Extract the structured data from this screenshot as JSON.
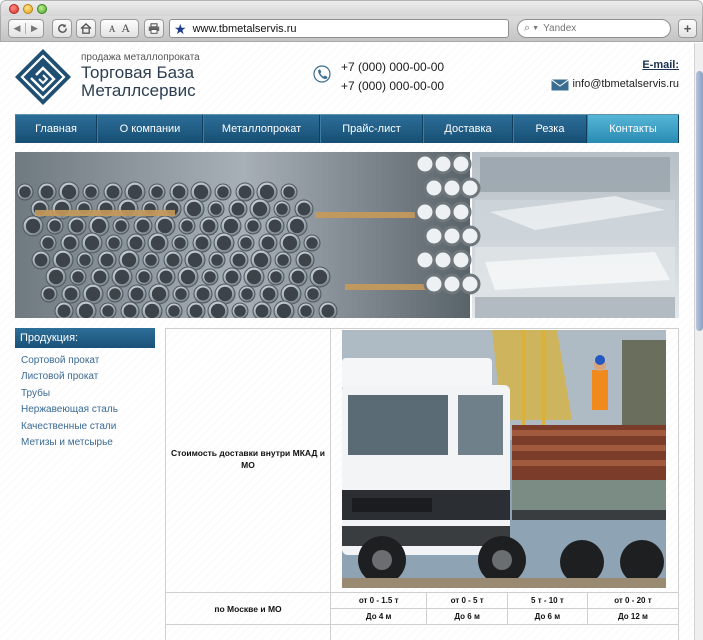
{
  "browser": {
    "nav_back": "◀",
    "nav_forward": "▶",
    "font_small": "A",
    "font_large": "A",
    "url": "www.tbmetalservis.ru",
    "search_placeholder": "Yandex",
    "add_label": "+"
  },
  "header": {
    "tagline": "продажа металлопроката",
    "company_line1": "Торговая База",
    "company_line2": "Металлсервис",
    "phones": [
      "+7 (000) 000-00-00",
      "+7 (000) 000-00-00"
    ],
    "email_label": "E-mail:",
    "email_value": "info@tbmetalservis.ru"
  },
  "menu": {
    "items": [
      {
        "label": "Главная",
        "width": 0
      },
      {
        "label": "О компании"
      },
      {
        "label": "Металлопрокат"
      },
      {
        "label": "Прайс-лист"
      },
      {
        "label": "Доставка"
      },
      {
        "label": "Резка"
      },
      {
        "label": "Контакты"
      }
    ],
    "active_index": 6
  },
  "sidebar": {
    "title": "Продукция:",
    "items": [
      "Сортовой прокат",
      "Листовой прокат",
      "Трубы",
      "Нержавеющая сталь",
      "Качественные стали",
      "Метизы и метсырье"
    ]
  },
  "content": {
    "delivery_caption": "Стоимость доставки внутри МКАД и МО",
    "table": {
      "region": "по Москве и МО",
      "weights": [
        "от 0 - 1.5 т",
        "от 0 - 5 т",
        "5 т - 10 т",
        "от 0 - 20 т"
      ],
      "lengths": [
        "До 4 м",
        "До 6 м",
        "До 6 м",
        "До 12 м"
      ]
    }
  },
  "colors": {
    "menu_bg": "#1f5f8a",
    "menu_active": "#3fa2c8",
    "link": "#3a6a95"
  }
}
